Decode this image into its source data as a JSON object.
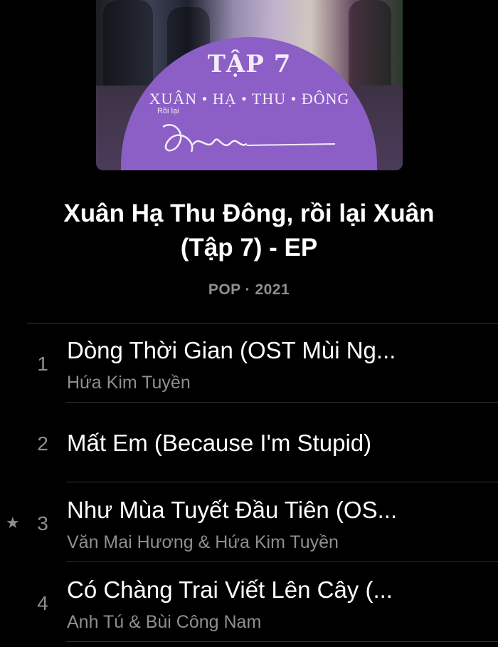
{
  "artwork": {
    "episode": "TẬP 7",
    "seasons": "XUÂN • HẠ • THU • ĐÔNG",
    "subtitle": "Rồi lại",
    "script_word": "Xuân"
  },
  "album": {
    "title_line1": "Xuân Hạ Thu Đông, rồi lại Xuân",
    "title_line2": "(Tập 7) - EP",
    "meta": "POP · 2021"
  },
  "tracks": [
    {
      "number": "1",
      "name": "Dòng Thời Gian (OST Mùi Ng...",
      "artist": "Hứa Kim Tuyền",
      "starred": false
    },
    {
      "number": "2",
      "name": "Mất Em (Because I'm Stupid)",
      "artist": "",
      "starred": false
    },
    {
      "number": "3",
      "name": "Như Mùa Tuyết Đầu Tiên (OS...",
      "artist": "Văn Mai Hương & Hứa Kim Tuyền",
      "starred": true,
      "star": "★"
    },
    {
      "number": "4",
      "name": "Có Chàng Trai Viết Lên Cây (...",
      "artist": "Anh Tú & Bùi Công Nam",
      "starred": false
    }
  ],
  "colors": {
    "background": "#000000",
    "secondary_text": "#8e8e93",
    "artwork_purple": "#8b5fc6"
  }
}
